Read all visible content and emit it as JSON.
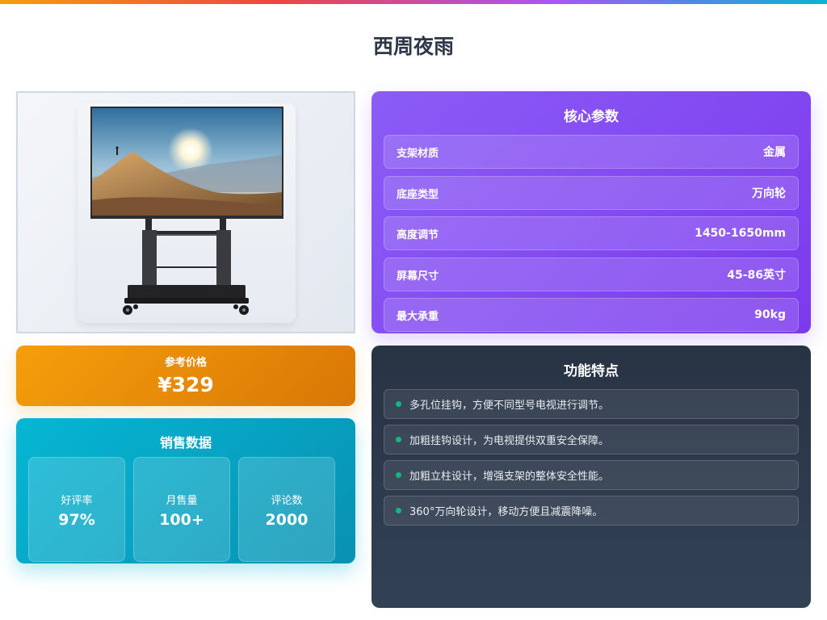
{
  "page": {
    "title": "西周夜雨"
  },
  "colors": {
    "price_gradient": [
      "#f59e0b",
      "#d97706"
    ],
    "sales_gradient": [
      "#06b6d4",
      "#0891b2"
    ],
    "specs_gradient": [
      "#8b5cf6",
      "#7c3aed"
    ],
    "features_bg": "#2d3748",
    "feature_bullet": "#10b981"
  },
  "product_image": {
    "icon": "tv-stand-image"
  },
  "price": {
    "label": "参考价格",
    "value": "¥329"
  },
  "sales": {
    "title": "销售数据",
    "stats": [
      {
        "label": "好评率",
        "value": "97%"
      },
      {
        "label": "月售量",
        "value": "100+"
      },
      {
        "label": "评论数",
        "value": "2000"
      }
    ]
  },
  "specs": {
    "title": "核心参数",
    "rows": [
      {
        "label": "支架材质",
        "value": "金属"
      },
      {
        "label": "底座类型",
        "value": "万向轮"
      },
      {
        "label": "高度调节",
        "value": "1450-1650mm"
      },
      {
        "label": "屏幕尺寸",
        "value": "45-86英寸"
      },
      {
        "label": "最大承重",
        "value": "90kg"
      }
    ]
  },
  "features": {
    "title": "功能特点",
    "items": [
      "多孔位挂钩，方便不同型号电视进行调节。",
      "加粗挂钩设计，为电视提供双重安全保障。",
      "加粗立柱设计，增强支架的整体安全性能。",
      "360°万向轮设计，移动方便且减震降噪。"
    ]
  }
}
